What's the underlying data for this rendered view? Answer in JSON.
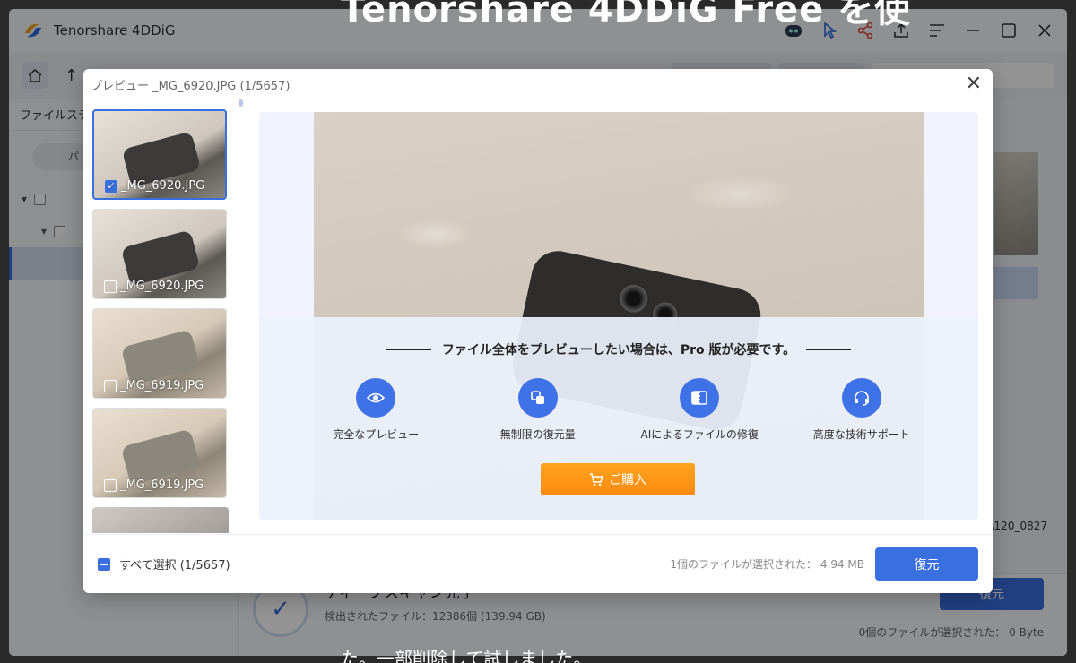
{
  "overlay": {
    "title": "Tenorshare 4DDiG Free を使",
    "caption": "た。一部削除して試しました。"
  },
  "app": {
    "title": "Tenorshare 4DDiG",
    "toolbar_icons": [
      "robot-icon",
      "cursor-icon",
      "share-icon",
      "upload-icon",
      "menu-icon",
      "minimize-icon",
      "maximize-icon",
      "close-icon"
    ],
    "sidebar": {
      "header": "ファイルステ",
      "pill": "パ"
    },
    "bottom": {
      "scan_title": "ディープスキャン完了",
      "scan_sub": "検出されたファイル：12386個 (139.94 GB)",
      "restore_label": "復元",
      "selection_info": "0個のファイルが選択された： 0 Byte"
    },
    "path_fragment": "\\120_0827"
  },
  "modal": {
    "title": "プレビュー _MG_6920.JPG (1/5657)",
    "thumbnails": [
      {
        "name": "_MG_6920.JPG",
        "checked": true
      },
      {
        "name": "_MG_6920.JPG",
        "checked": false
      },
      {
        "name": "_MG_6919.JPG",
        "checked": false
      },
      {
        "name": "_MG_6919.JPG",
        "checked": false
      }
    ],
    "upsell": {
      "headline": "ファイル全体をプレビューしたい場合は、Pro 版が必要です。",
      "features": [
        {
          "label": "完全なプレビュー",
          "icon": "eye-icon"
        },
        {
          "label": "無制限の復元量",
          "icon": "infinity-icon"
        },
        {
          "label": "AIによるファイルの修復",
          "icon": "repair-icon"
        },
        {
          "label": "高度な技術サポート",
          "icon": "headset-icon"
        }
      ],
      "buy_label": "ご購入"
    },
    "footer": {
      "select_all": "すべて選択 (1/5657)",
      "selection_info": "1個のファイルが選択された：  4.94 MB",
      "restore_label": "復元"
    }
  }
}
